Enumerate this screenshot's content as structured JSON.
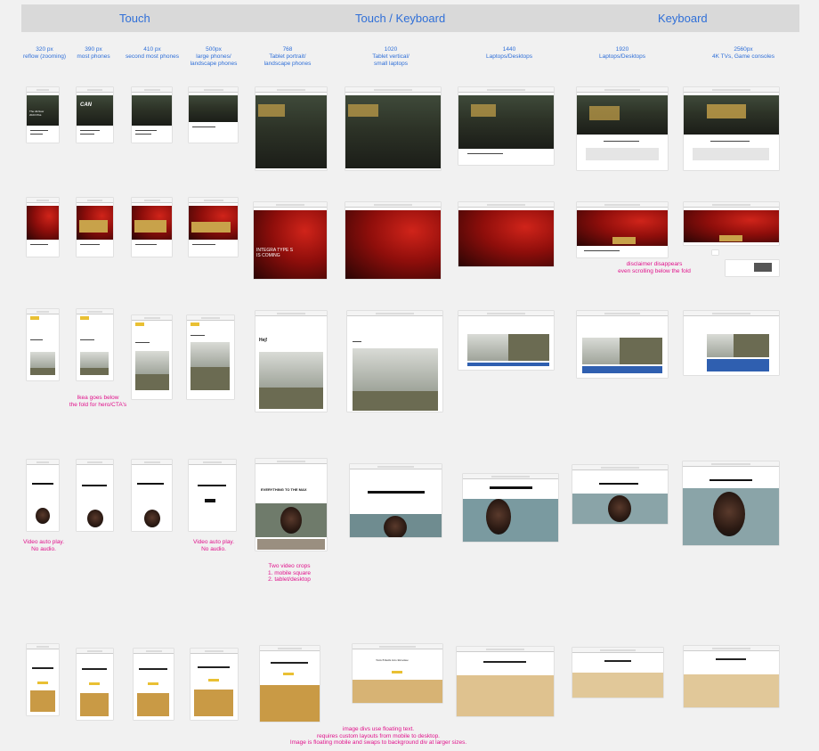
{
  "header": {
    "left": "Touch",
    "center": "Touch / Keyboard",
    "right": "Keyboard"
  },
  "columns": [
    "320 px\nreflow (zooming)",
    "390 px\nmost phones",
    "410 px\nsecond most phones",
    "500px\nlarge phones/\nlandscape phones",
    "768\nTablet portrait/\nlandscape phones",
    "1020\nTablet vertical/\nsmall laptops",
    "1440\nLaptops/Desktops",
    "1920\nLaptops/Desktops",
    "2560px\n4K TVs, Game consoles"
  ],
  "hero_text": {
    "honda_tagline": "CAN",
    "honda_title": "The All-New\n2023 Pilot.",
    "acura_title": "INTEGRA TYPE S\nIS COMING",
    "ikea_heading": "Hej!",
    "nike_title": "EVERYTHING TO THE MAX",
    "attentive_title": "Turn Emails into Revenue"
  },
  "notes": {
    "acura": "disclaimer disappears\neven scrolling below the fold",
    "ikea": "Ikea goes below\nthe fold for hero/CTA's",
    "nike_video1": "Video  auto play.\nNo audio.",
    "nike_video2": "Video  auto play.\nNo audio.",
    "nike_crops": "Two video crops\n1. mobile square\n2. tablet/desktop",
    "attentive": "image divs use floating text.\nrequires custom layouts from mobile to desktop.\nImage is floating mobile and swaps to background div at larger sizes."
  },
  "colors": {
    "label_blue": "#2f6fd8",
    "note_magenta": "#e0138c",
    "header_bg": "#d9d9d9"
  }
}
